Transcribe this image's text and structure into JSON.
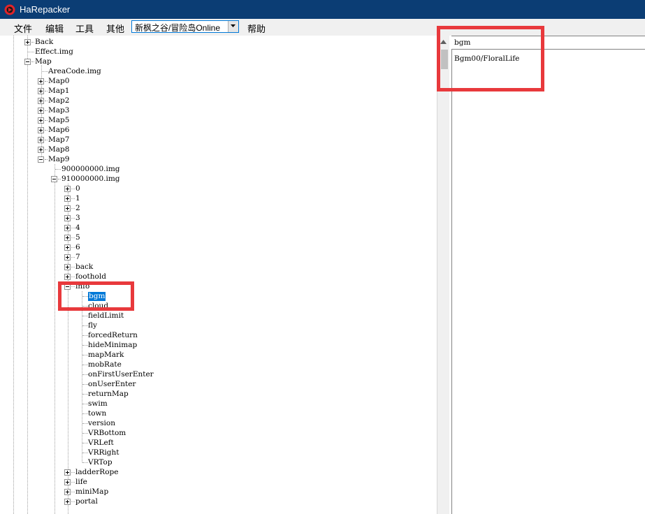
{
  "window": {
    "title": "HaRepacker"
  },
  "menu": {
    "items": [
      "文件",
      "编辑",
      "工具",
      "其他"
    ],
    "combo_value": "新枫之谷/冒险岛Online",
    "help": "帮助"
  },
  "tree": {
    "back": "Back",
    "effect": "Effect.img",
    "map": "Map",
    "areacode": "AreaCode.img",
    "maps": [
      "Map0",
      "Map1",
      "Map2",
      "Map3",
      "Map5",
      "Map6",
      "Map7",
      "Map8",
      "Map9"
    ],
    "img1": "900000000.img",
    "img2": "910000000.img",
    "layers": [
      "0",
      "1",
      "2",
      "3",
      "4",
      "5",
      "6",
      "7"
    ],
    "back_node": "back",
    "foothold": "foothold",
    "info": "info",
    "info_children": [
      "bgm",
      "cloud",
      "fieldLimit",
      "fly",
      "forcedReturn",
      "hideMinimap",
      "mapMark",
      "mobRate",
      "onFirstUserEnter",
      "onUserEnter",
      "returnMap",
      "swim",
      "town",
      "version",
      "VRBottom",
      "VRLeft",
      "VRRight",
      "VRTop"
    ],
    "after_info": [
      "ladderRope",
      "life",
      "miniMap",
      "portal"
    ]
  },
  "property": {
    "name": "bgm",
    "value": "Bgm00/FloralLife"
  },
  "colors": {
    "titlebar": "#0b3d74",
    "selection": "#0078d7",
    "highlight_box": "#e8393c"
  }
}
